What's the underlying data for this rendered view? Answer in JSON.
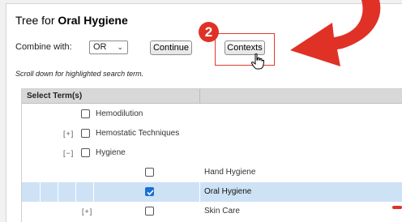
{
  "header": {
    "title_prefix": "Tree for ",
    "title_term": "Oral Hygiene"
  },
  "controls": {
    "combine_label": "Combine with:",
    "combine_value": "OR",
    "continue_label": "Continue",
    "contexts_label": "Contexts"
  },
  "annotation": {
    "step_number": "2",
    "accent_color": "#e03127"
  },
  "hint": "Scroll down for highlighted search term.",
  "table": {
    "header": "Select Term(s)",
    "rows": [
      {
        "expander": "",
        "label": "Hemodilution",
        "checked": false,
        "selected": false
      },
      {
        "expander": "[+]",
        "label": "Hemostatic Techniques",
        "checked": false,
        "selected": false
      },
      {
        "expander": "[−]",
        "label": "Hygiene",
        "checked": false,
        "selected": false
      },
      {
        "expander": "",
        "label": "Hand Hygiene",
        "checked": false,
        "selected": false
      },
      {
        "expander": "",
        "label": "Oral Hygiene",
        "checked": true,
        "selected": true
      },
      {
        "expander": "[+]",
        "label": "Skin Care",
        "checked": false,
        "selected": false
      }
    ]
  }
}
